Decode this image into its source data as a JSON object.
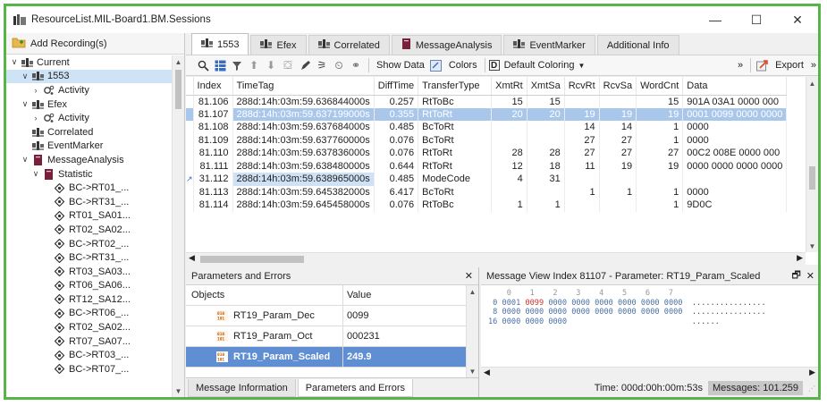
{
  "window": {
    "title": "ResourceList.MIL-Board1.BM.Sessions",
    "minimize": "—",
    "maximize": "☐",
    "close": "✕"
  },
  "left_panel": {
    "add_recording": "Add Recording(s)",
    "tree": [
      {
        "label": "Current",
        "level": 0,
        "exp": "∨",
        "icon": "recording-icon",
        "sel": false
      },
      {
        "label": "1553",
        "level": 1,
        "exp": "∨",
        "icon": "recording-icon",
        "sel": true
      },
      {
        "label": "Activity",
        "level": 2,
        "exp": "›",
        "icon": "activity-icon",
        "sel": false
      },
      {
        "label": "Efex",
        "level": 1,
        "exp": "∨",
        "icon": "recording-icon",
        "sel": false
      },
      {
        "label": "Activity",
        "level": 2,
        "exp": "›",
        "icon": "activity-icon",
        "sel": false
      },
      {
        "label": "Correlated",
        "level": 1,
        "exp": "",
        "icon": "recording-icon",
        "sel": false
      },
      {
        "label": "EventMarker",
        "level": 1,
        "exp": "",
        "icon": "recording-icon",
        "sel": false
      },
      {
        "label": "MessageAnalysis",
        "level": 1,
        "exp": "∨",
        "icon": "analysis-icon",
        "sel": false
      },
      {
        "label": "Statistic",
        "level": 2,
        "exp": "∨",
        "icon": "analysis-icon",
        "sel": false
      },
      {
        "label": "BC->RT01_...",
        "level": 3,
        "exp": "",
        "icon": "message-icon",
        "sel": false
      },
      {
        "label": "BC->RT31_...",
        "level": 3,
        "exp": "",
        "icon": "message-icon",
        "sel": false
      },
      {
        "label": "RT01_SA01...",
        "level": 3,
        "exp": "",
        "icon": "message-icon",
        "sel": false
      },
      {
        "label": "RT02_SA02...",
        "level": 3,
        "exp": "",
        "icon": "message-icon",
        "sel": false
      },
      {
        "label": "BC->RT02_...",
        "level": 3,
        "exp": "",
        "icon": "message-icon",
        "sel": false
      },
      {
        "label": "BC->RT31_...",
        "level": 3,
        "exp": "",
        "icon": "message-icon",
        "sel": false
      },
      {
        "label": "RT03_SA03...",
        "level": 3,
        "exp": "",
        "icon": "message-icon",
        "sel": false
      },
      {
        "label": "RT06_SA06...",
        "level": 3,
        "exp": "",
        "icon": "message-icon",
        "sel": false
      },
      {
        "label": "RT12_SA12...",
        "level": 3,
        "exp": "",
        "icon": "message-icon",
        "sel": false
      },
      {
        "label": "BC->RT06_...",
        "level": 3,
        "exp": "",
        "icon": "message-icon",
        "sel": false
      },
      {
        "label": "RT02_SA02...",
        "level": 3,
        "exp": "",
        "icon": "message-icon",
        "sel": false
      },
      {
        "label": "RT07_SA07...",
        "level": 3,
        "exp": "",
        "icon": "message-icon",
        "sel": false
      },
      {
        "label": "BC->RT03_...",
        "level": 3,
        "exp": "",
        "icon": "message-icon",
        "sel": false
      },
      {
        "label": "BC->RT07_...",
        "level": 3,
        "exp": "",
        "icon": "message-icon",
        "sel": false
      }
    ]
  },
  "tabs": [
    {
      "label": "1553",
      "active": true,
      "icon": "recording-icon"
    },
    {
      "label": "Efex",
      "active": false,
      "icon": "recording-icon"
    },
    {
      "label": "Correlated",
      "active": false,
      "icon": "recording-icon"
    },
    {
      "label": "MessageAnalysis",
      "active": false,
      "icon": "analysis-icon"
    },
    {
      "label": "EventMarker",
      "active": false,
      "icon": "recording-icon"
    },
    {
      "label": "Additional Info",
      "active": false,
      "icon": ""
    }
  ],
  "toolbar": {
    "show_data": "Show Data",
    "colors": "Colors",
    "coloring": "Default Coloring",
    "more": "»",
    "export": "Export",
    "export_more": "»"
  },
  "grid": {
    "columns": [
      "Index",
      "TimeTag",
      "DiffTime",
      "TransferType",
      "XmtRt",
      "XmtSa",
      "RcvRt",
      "RcvSa",
      "WordCnt",
      "Data"
    ],
    "rows": [
      {
        "marker": "",
        "cells": [
          "81.106",
          "288d:14h:03m:59.636844000s",
          "0.257",
          "RtToBc",
          "15",
          "15",
          "",
          "",
          "15",
          "901A 03A1 0000 000"
        ],
        "hl": false,
        "timesel": false
      },
      {
        "marker": "",
        "cells": [
          "81.107",
          "288d:14h:03m:59.637199000s",
          "0.355",
          "RtToRt",
          "20",
          "20",
          "19",
          "19",
          "19",
          "0001 0099 0000 0000"
        ],
        "hl": true,
        "timesel": false
      },
      {
        "marker": "",
        "cells": [
          "81.108",
          "288d:14h:03m:59.637684000s",
          "0.485",
          "BcToRt",
          "",
          "",
          "14",
          "14",
          "1",
          "0000"
        ],
        "hl": false,
        "timesel": false
      },
      {
        "marker": "",
        "cells": [
          "81.109",
          "288d:14h:03m:59.637760000s",
          "0.076",
          "BcToRt",
          "",
          "",
          "27",
          "27",
          "1",
          "0000"
        ],
        "hl": false,
        "timesel": false
      },
      {
        "marker": "",
        "cells": [
          "81.110",
          "288d:14h:03m:59.637836000s",
          "0.076",
          "RtToRt",
          "28",
          "28",
          "27",
          "27",
          "27",
          "00C2 008E 0000 000"
        ],
        "hl": false,
        "timesel": false
      },
      {
        "marker": "",
        "cells": [
          "81.111",
          "288d:14h:03m:59.638480000s",
          "0.644",
          "RtToRt",
          "12",
          "18",
          "11",
          "19",
          "19",
          "0000 0000 0000 0000"
        ],
        "hl": false,
        "timesel": false
      },
      {
        "marker": "↗",
        "cells": [
          "31.112",
          "288d:14h:03m:59.638965000s",
          "0.485",
          "ModeCode",
          "4",
          "31",
          "",
          "",
          "",
          ""
        ],
        "hl": false,
        "timesel": true
      },
      {
        "marker": "",
        "cells": [
          "81.113",
          "288d:14h:03m:59.645382000s",
          "6.417",
          "BcToRt",
          "",
          "",
          "1",
          "1",
          "1",
          "0000"
        ],
        "hl": false,
        "timesel": false
      },
      {
        "marker": "",
        "cells": [
          "81.114",
          "288d:14h:03m:59.645458000s",
          "0.076",
          "RtToBc",
          "1",
          "1",
          "",
          "",
          "1",
          "9D0C"
        ],
        "hl": false,
        "timesel": false
      }
    ]
  },
  "params_panel": {
    "title": "Parameters and Errors",
    "close": "✕",
    "col_objects": "Objects",
    "col_value": "Value",
    "rows": [
      {
        "name": "RT19_Param_Dec",
        "value": "0099",
        "sel": false
      },
      {
        "name": "RT19_Param_Oct",
        "value": "000231",
        "sel": false
      },
      {
        "name": "RT19_Param_Scaled",
        "value": "249.9",
        "sel": true
      }
    ],
    "bottom_tabs": [
      {
        "label": "Message Information",
        "active": false
      },
      {
        "label": "Parameters and Errors",
        "active": true
      }
    ]
  },
  "message_view": {
    "title": "Message View Index 81107 - Parameter: RT19_Param_Scaled",
    "pin": "🗗",
    "close": "✕",
    "col_header": "    0    1    2    3    4    5    6    7",
    "lines": [
      {
        "offset": " 0",
        "words": [
          "0001",
          "0099",
          "0000",
          "0000",
          "0000",
          "0000",
          "0000",
          "0000"
        ],
        "ascii": "................"
      },
      {
        "offset": " 8",
        "words": [
          "0000",
          "0000",
          "0000",
          "0000",
          "0000",
          "0000",
          "0000",
          "0000"
        ],
        "ascii": "................"
      },
      {
        "offset": "16",
        "words": [
          "0000",
          "0000",
          "0000"
        ],
        "ascii": "......"
      }
    ],
    "status_time": "Time: 000d:00h:00m:53s",
    "status_messages": "Messages: 101.259"
  }
}
